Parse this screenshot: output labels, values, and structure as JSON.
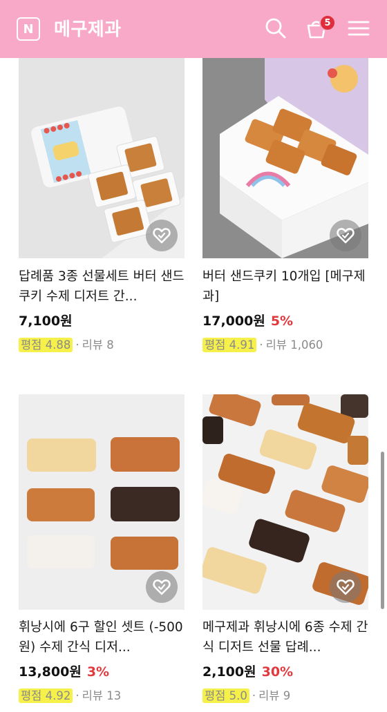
{
  "header": {
    "logo_letter": "N",
    "store_name": "메구제과",
    "cart_count": "5",
    "icons": [
      "search-icon",
      "cart-icon",
      "menu-icon"
    ],
    "bg_color": "#f8a9c8"
  },
  "products": [
    {
      "title": "답례품 3종 선물세트 버터 샌드쿠키 수제 디저트 간...",
      "price": "7,100원",
      "discount": "",
      "rating_label": "평점 4.88",
      "review_label": "리뷰 8"
    },
    {
      "title": "버터 샌드쿠키 10개입 [메구제과]",
      "price": "17,000원",
      "discount": "5%",
      "rating_label": "평점 4.91",
      "review_label": "리뷰 1,060"
    },
    {
      "title": "휘낭시에 6구 할인 셋트 (-500원) 수제 간식 디저...",
      "price": "13,800원",
      "discount": "3%",
      "rating_label": "평점 4.92",
      "review_label": "리뷰 13"
    },
    {
      "title": "메구제과 휘낭시에 6종 수제 간식 디저트 선물 답례...",
      "price": "2,100원",
      "discount": "30%",
      "rating_label": "평점 5.0",
      "review_label": "리뷰 9"
    }
  ],
  "colors": {
    "discount": "#e0393e",
    "highlight": "#f6f04a"
  }
}
